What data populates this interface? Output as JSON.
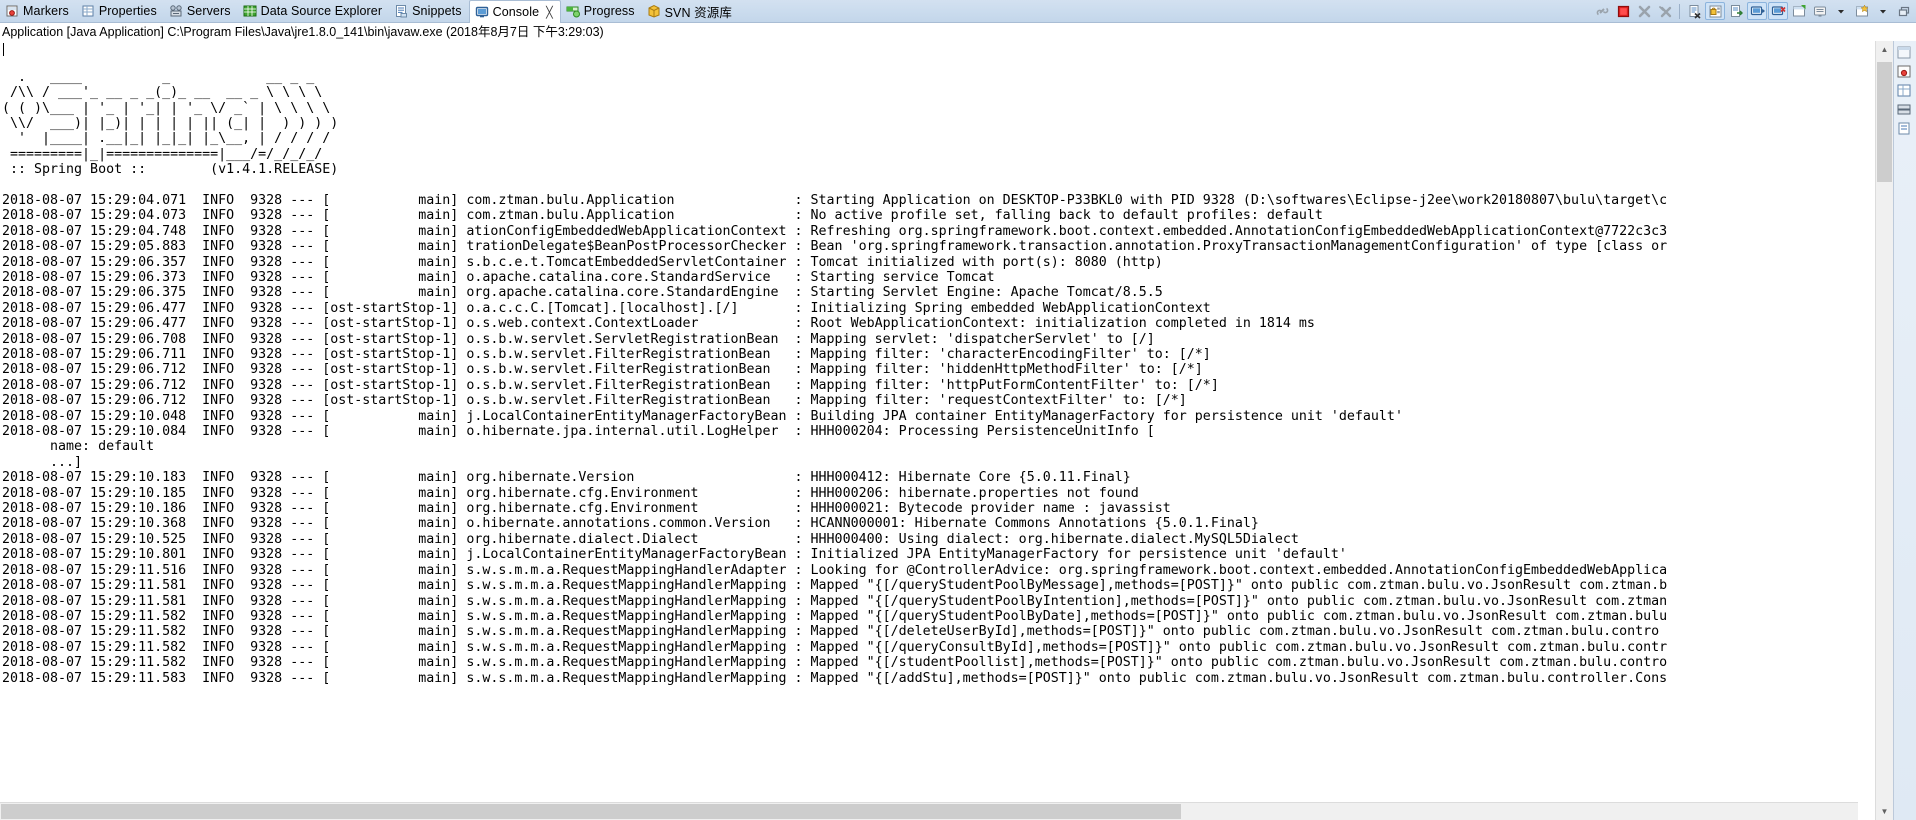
{
  "window": {
    "tabs": [
      {
        "label": "Markers",
        "icon": "markers-icon",
        "active": false
      },
      {
        "label": "Properties",
        "icon": "properties-icon",
        "active": false
      },
      {
        "label": "Servers",
        "icon": "servers-icon",
        "active": false
      },
      {
        "label": "Data Source Explorer",
        "icon": "database-icon",
        "active": false
      },
      {
        "label": "Snippets",
        "icon": "snippets-icon",
        "active": false
      },
      {
        "label": "Console",
        "icon": "console-icon",
        "active": true,
        "close": "╳"
      },
      {
        "label": "Progress",
        "icon": "progress-icon",
        "active": false
      },
      {
        "label": "SVN 资源库",
        "icon": "svn-icon",
        "active": false
      }
    ],
    "toolbar": [
      {
        "name": "link-with-editor-button",
        "state": "off"
      },
      {
        "name": "terminate-button",
        "state": "off"
      },
      {
        "name": "remove-launch-button",
        "state": "off"
      },
      {
        "name": "remove-all-terminated-button",
        "state": "off"
      },
      {
        "name": "separator",
        "state": "sep"
      },
      {
        "name": "clear-console-button",
        "state": "off"
      },
      {
        "name": "scroll-lock-button",
        "state": "on"
      },
      {
        "name": "word-wrap-button",
        "state": "off"
      },
      {
        "name": "show-console-on-output-button",
        "state": "on"
      },
      {
        "name": "show-console-on-error-button",
        "state": "on"
      },
      {
        "name": "pin-console-button",
        "state": "off"
      },
      {
        "name": "display-selected-console-button",
        "state": "off"
      },
      {
        "name": "display-selected-console-dropdown",
        "state": "arrow"
      },
      {
        "name": "open-console-button",
        "state": "off"
      },
      {
        "name": "open-console-dropdown",
        "state": "arrow"
      },
      {
        "name": "minimize-restore-button",
        "state": "off"
      }
    ],
    "rail_icons": [
      "view-menu-icon",
      "markers-rail-icon",
      "properties-rail-icon",
      "servers-rail-icon",
      "snippets-rail-icon"
    ]
  },
  "console": {
    "header": "Application [Java Application] C:\\Program Files\\Java\\jre1.8.0_141\\bin\\javaw.exe (2018年8月7日 下午3:29:03)",
    "scroll": {
      "vertical_percent": 3,
      "horizontal_percent": 0
    },
    "banner": [
      "",
      "  .   ____          _            __ _ _",
      " /\\\\ / ___'_ __ _ _(_)_ __  __ _ \\ \\ \\ \\",
      "( ( )\\___ | '_ | '_| | '_ \\/ _` | \\ \\ \\ \\",
      " \\\\/  ___)| |_)| | | | | || (_| |  ) ) ) )",
      "  '  |____| .__|_| |_|_| |_\\__, | / / / /",
      " =========|_|==============|___/=/_/_/_/",
      " :: Spring Boot ::        (v1.4.1.RELEASE)",
      ""
    ],
    "log_lines": [
      {
        "ts": "2018-08-07 15:29:04.071",
        "level": "INFO",
        "pid": "9328",
        "thread": "main",
        "logger": "com.ztman.bulu.Application",
        "msg": "Starting Application on DESKTOP-P33BKL0 with PID 9328 (D:\\softwares\\Eclipse-j2ee\\work20180807\\bulu\\target\\c"
      },
      {
        "ts": "2018-08-07 15:29:04.073",
        "level": "INFO",
        "pid": "9328",
        "thread": "main",
        "logger": "com.ztman.bulu.Application",
        "msg": "No active profile set, falling back to default profiles: default"
      },
      {
        "ts": "2018-08-07 15:29:04.748",
        "level": "INFO",
        "pid": "9328",
        "thread": "main",
        "logger": "ationConfigEmbeddedWebApplicationContext",
        "msg": "Refreshing org.springframework.boot.context.embedded.AnnotationConfigEmbeddedWebApplicationContext@7722c3c3"
      },
      {
        "ts": "2018-08-07 15:29:05.883",
        "level": "INFO",
        "pid": "9328",
        "thread": "main",
        "logger": "trationDelegate$BeanPostProcessorChecker",
        "msg": "Bean 'org.springframework.transaction.annotation.ProxyTransactionManagementConfiguration' of type [class or"
      },
      {
        "ts": "2018-08-07 15:29:06.357",
        "level": "INFO",
        "pid": "9328",
        "thread": "main",
        "logger": "s.b.c.e.t.TomcatEmbeddedServletContainer",
        "msg": "Tomcat initialized with port(s): 8080 (http)"
      },
      {
        "ts": "2018-08-07 15:29:06.373",
        "level": "INFO",
        "pid": "9328",
        "thread": "main",
        "logger": "o.apache.catalina.core.StandardService",
        "msg": "Starting service Tomcat"
      },
      {
        "ts": "2018-08-07 15:29:06.375",
        "level": "INFO",
        "pid": "9328",
        "thread": "main",
        "logger": "org.apache.catalina.core.StandardEngine",
        "msg": "Starting Servlet Engine: Apache Tomcat/8.5.5"
      },
      {
        "ts": "2018-08-07 15:29:06.477",
        "level": "INFO",
        "pid": "9328",
        "thread": "ost-startStop-1",
        "logger": "o.a.c.c.C.[Tomcat].[localhost].[/]",
        "msg": "Initializing Spring embedded WebApplicationContext"
      },
      {
        "ts": "2018-08-07 15:29:06.477",
        "level": "INFO",
        "pid": "9328",
        "thread": "ost-startStop-1",
        "logger": "o.s.web.context.ContextLoader",
        "msg": "Root WebApplicationContext: initialization completed in 1814 ms"
      },
      {
        "ts": "2018-08-07 15:29:06.708",
        "level": "INFO",
        "pid": "9328",
        "thread": "ost-startStop-1",
        "logger": "o.s.b.w.servlet.ServletRegistrationBean",
        "msg": "Mapping servlet: 'dispatcherServlet' to [/]"
      },
      {
        "ts": "2018-08-07 15:29:06.711",
        "level": "INFO",
        "pid": "9328",
        "thread": "ost-startStop-1",
        "logger": "o.s.b.w.servlet.FilterRegistrationBean",
        "msg": "Mapping filter: 'characterEncodingFilter' to: [/*]"
      },
      {
        "ts": "2018-08-07 15:29:06.712",
        "level": "INFO",
        "pid": "9328",
        "thread": "ost-startStop-1",
        "logger": "o.s.b.w.servlet.FilterRegistrationBean",
        "msg": "Mapping filter: 'hiddenHttpMethodFilter' to: [/*]"
      },
      {
        "ts": "2018-08-07 15:29:06.712",
        "level": "INFO",
        "pid": "9328",
        "thread": "ost-startStop-1",
        "logger": "o.s.b.w.servlet.FilterRegistrationBean",
        "msg": "Mapping filter: 'httpPutFormContentFilter' to: [/*]"
      },
      {
        "ts": "2018-08-07 15:29:06.712",
        "level": "INFO",
        "pid": "9328",
        "thread": "ost-startStop-1",
        "logger": "o.s.b.w.servlet.FilterRegistrationBean",
        "msg": "Mapping filter: 'requestContextFilter' to: [/*]"
      },
      {
        "ts": "2018-08-07 15:29:10.048",
        "level": "INFO",
        "pid": "9328",
        "thread": "main",
        "logger": "j.LocalContainerEntityManagerFactoryBean",
        "msg": "Building JPA container EntityManagerFactory for persistence unit 'default'"
      },
      {
        "ts": "2018-08-07 15:29:10.084",
        "level": "INFO",
        "pid": "9328",
        "thread": "main",
        "logger": "o.hibernate.jpa.internal.util.LogHelper",
        "msg": "HHH000204: Processing PersistenceUnitInfo ["
      },
      {
        "raw": "\tname: default"
      },
      {
        "raw": "\t...]"
      },
      {
        "ts": "2018-08-07 15:29:10.183",
        "level": "INFO",
        "pid": "9328",
        "thread": "main",
        "logger": "org.hibernate.Version",
        "msg": "HHH000412: Hibernate Core {5.0.11.Final}"
      },
      {
        "ts": "2018-08-07 15:29:10.185",
        "level": "INFO",
        "pid": "9328",
        "thread": "main",
        "logger": "org.hibernate.cfg.Environment",
        "msg": "HHH000206: hibernate.properties not found"
      },
      {
        "ts": "2018-08-07 15:29:10.186",
        "level": "INFO",
        "pid": "9328",
        "thread": "main",
        "logger": "org.hibernate.cfg.Environment",
        "msg": "HHH000021: Bytecode provider name : javassist"
      },
      {
        "ts": "2018-08-07 15:29:10.368",
        "level": "INFO",
        "pid": "9328",
        "thread": "main",
        "logger": "o.hibernate.annotations.common.Version",
        "msg": "HCANN000001: Hibernate Commons Annotations {5.0.1.Final}"
      },
      {
        "ts": "2018-08-07 15:29:10.525",
        "level": "INFO",
        "pid": "9328",
        "thread": "main",
        "logger": "org.hibernate.dialect.Dialect",
        "msg": "HHH000400: Using dialect: org.hibernate.dialect.MySQL5Dialect"
      },
      {
        "ts": "2018-08-07 15:29:10.801",
        "level": "INFO",
        "pid": "9328",
        "thread": "main",
        "logger": "j.LocalContainerEntityManagerFactoryBean",
        "msg": "Initialized JPA EntityManagerFactory for persistence unit 'default'"
      },
      {
        "ts": "2018-08-07 15:29:11.516",
        "level": "INFO",
        "pid": "9328",
        "thread": "main",
        "logger": "s.w.s.m.m.a.RequestMappingHandlerAdapter",
        "msg": "Looking for @ControllerAdvice: org.springframework.boot.context.embedded.AnnotationConfigEmbeddedWebApplica"
      },
      {
        "ts": "2018-08-07 15:29:11.581",
        "level": "INFO",
        "pid": "9328",
        "thread": "main",
        "logger": "s.w.s.m.m.a.RequestMappingHandlerMapping",
        "msg": "Mapped \"{[/queryStudentPoolByMessage],methods=[POST]}\" onto public com.ztman.bulu.vo.JsonResult com.ztman.b"
      },
      {
        "ts": "2018-08-07 15:29:11.581",
        "level": "INFO",
        "pid": "9328",
        "thread": "main",
        "logger": "s.w.s.m.m.a.RequestMappingHandlerMapping",
        "msg": "Mapped \"{[/queryStudentPoolByIntention],methods=[POST]}\" onto public com.ztman.bulu.vo.JsonResult com.ztman"
      },
      {
        "ts": "2018-08-07 15:29:11.582",
        "level": "INFO",
        "pid": "9328",
        "thread": "main",
        "logger": "s.w.s.m.m.a.RequestMappingHandlerMapping",
        "msg": "Mapped \"{[/queryStudentPoolByDate],methods=[POST]}\" onto public com.ztman.bulu.vo.JsonResult com.ztman.bulu"
      },
      {
        "ts": "2018-08-07 15:29:11.582",
        "level": "INFO",
        "pid": "9328",
        "thread": "main",
        "logger": "s.w.s.m.m.a.RequestMappingHandlerMapping",
        "msg": "Mapped \"{[/deleteUserById],methods=[POST]}\" onto public com.ztman.bulu.vo.JsonResult com.ztman.bulu.contro"
      },
      {
        "ts": "2018-08-07 15:29:11.582",
        "level": "INFO",
        "pid": "9328",
        "thread": "main",
        "logger": "s.w.s.m.m.a.RequestMappingHandlerMapping",
        "msg": "Mapped \"{[/queryConsultById],methods=[POST]}\" onto public com.ztman.bulu.vo.JsonResult com.ztman.bulu.contr"
      },
      {
        "ts": "2018-08-07 15:29:11.582",
        "level": "INFO",
        "pid": "9328",
        "thread": "main",
        "logger": "s.w.s.m.m.a.RequestMappingHandlerMapping",
        "msg": "Mapped \"{[/studentPoollist],methods=[POST]}\" onto public com.ztman.bulu.vo.JsonResult com.ztman.bulu.contro"
      },
      {
        "ts": "2018-08-07 15:29:11.583",
        "level": "INFO",
        "pid": "9328",
        "thread": "main",
        "logger": "s.w.s.m.m.a.RequestMappingHandlerMapping",
        "msg": "Mapped \"{[/addStu],methods=[POST]}\" onto public com.ztman.bulu.vo.JsonResult com.ztman.bulu.controller.Cons"
      }
    ]
  },
  "colors": {
    "tabbar_bg": "#cbdcee",
    "tab_active_bg": "#ffffff",
    "console_bg": "#ffffff",
    "console_text": "#000000",
    "terminate_red": "#e02020",
    "scrollbar_thumb": "#cdcdcd"
  }
}
